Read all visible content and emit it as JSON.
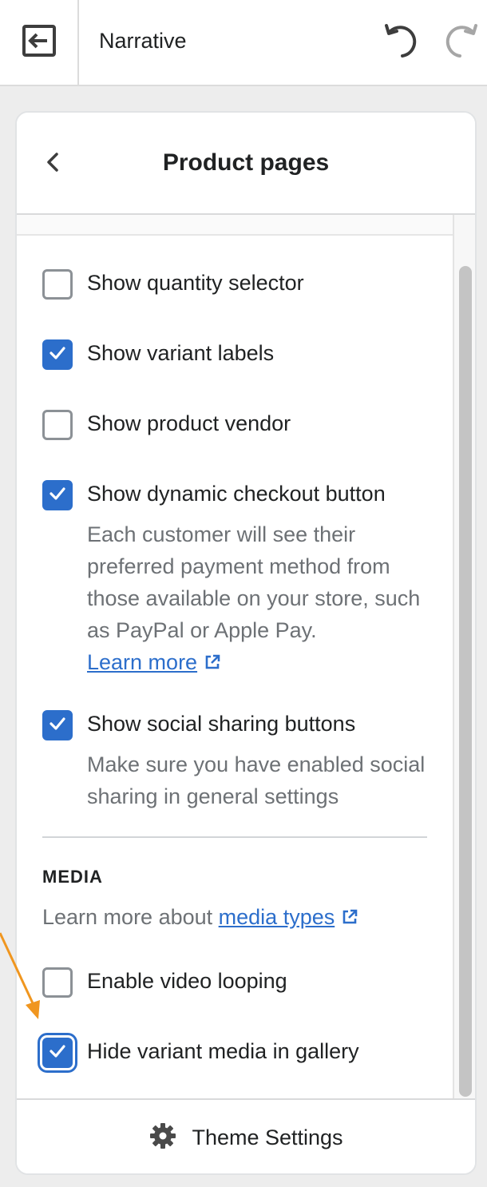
{
  "topbar": {
    "title": "Narrative",
    "exit_icon": "exit-icon",
    "undo_icon": "undo-icon",
    "redo_icon": "redo-icon"
  },
  "panel": {
    "title": "Product pages",
    "back_icon": "chevron-left-icon"
  },
  "options": [
    {
      "label": "Show quantity selector",
      "checked": false
    },
    {
      "label": "Show variant labels",
      "checked": true
    },
    {
      "label": "Show product vendor",
      "checked": false
    },
    {
      "label": "Show dynamic checkout button",
      "checked": true,
      "help": "Each customer will see their preferred payment method from those available on your store, such as PayPal or Apple Pay.",
      "link": "Learn more"
    },
    {
      "label": "Show social sharing buttons",
      "checked": true,
      "help": "Make sure you have enabled social sharing in general settings"
    }
  ],
  "media": {
    "heading": "MEDIA",
    "help_prefix": "Learn more about",
    "help_link": "media types",
    "options": [
      {
        "label": "Enable video looping",
        "checked": false
      },
      {
        "label": "Hide variant media in gallery",
        "checked": true,
        "focused": true
      }
    ]
  },
  "footer": {
    "label": "Theme Settings",
    "icon": "gear-icon"
  },
  "colors": {
    "accent": "#2c6ecb",
    "annotation_arrow": "#f0961f"
  }
}
